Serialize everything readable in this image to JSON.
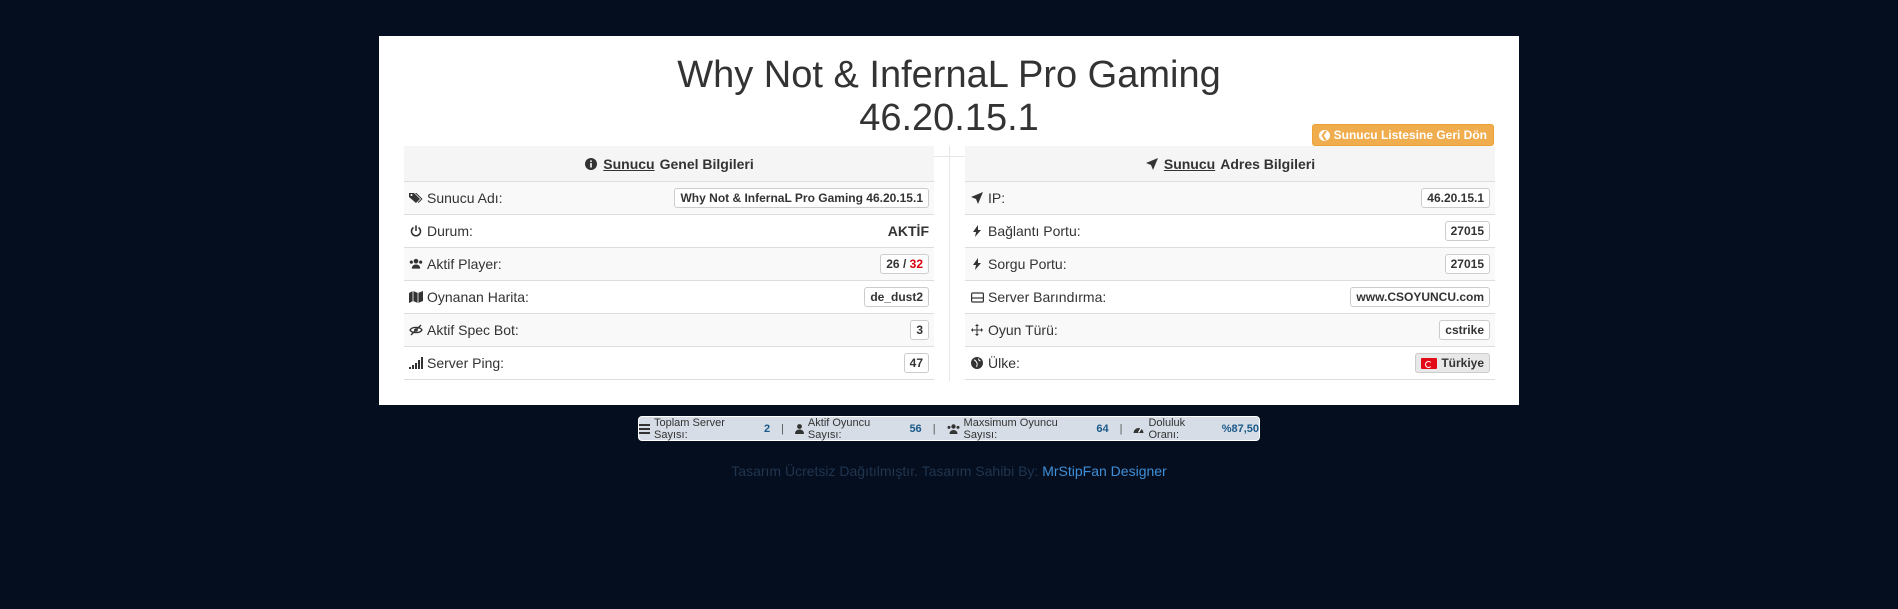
{
  "title": "Why Not & InfernaL Pro Gaming 46.20.15.1",
  "back_button": "Sunucu Listesine Geri Dön",
  "general": {
    "heading_pre": "Sunucu",
    "heading_post": "Genel Bilgileri",
    "rows": [
      {
        "label": "Sunucu Adı:",
        "value": "Why Not & InfernaL Pro Gaming 46.20.15.1",
        "icon": "tags-icon"
      },
      {
        "label": "Durum:",
        "value": "AKTİF",
        "icon": "power-icon"
      },
      {
        "label": "Aktif Player:",
        "value_a": "26",
        "value_sep": "/",
        "value_b": "32",
        "icon": "users-icon"
      },
      {
        "label": "Oynanan Harita:",
        "value": "de_dust2",
        "icon": "map-icon"
      },
      {
        "label": "Aktif Spec Bot:",
        "value": "3",
        "icon": "eye-slash-icon"
      },
      {
        "label": "Server Ping:",
        "value": "47",
        "icon": "signal-icon"
      }
    ]
  },
  "address": {
    "heading_pre": "Sunucu",
    "heading_post": "Adres Bilgileri",
    "rows": [
      {
        "label": "IP:",
        "value": "46.20.15.1",
        "icon": "location-arrow-icon"
      },
      {
        "label": "Bağlantı Portu:",
        "value": "27015",
        "icon": "bolt-icon"
      },
      {
        "label": "Sorgu Portu:",
        "value": "27015",
        "icon": "bolt-icon"
      },
      {
        "label": "Server Barındırma:",
        "value": "www.CSOYUNCU.com",
        "icon": "hdd-icon"
      },
      {
        "label": "Oyun Türü:",
        "value": "cstrike",
        "icon": "crosshairs-icon"
      },
      {
        "label": "Ülke:",
        "value": "Türkiye",
        "icon": "globe-icon"
      }
    ]
  },
  "stats": {
    "total_label": "Toplam Server Sayısı:",
    "total_value": "2",
    "active_label": "Aktif Oyuncu Sayısı:",
    "active_value": "56",
    "max_label": "Maxsimum Oyuncu Sayısı:",
    "max_value": "64",
    "fill_label": "Doluluk Oranı:",
    "fill_value": "%87,50"
  },
  "footer": {
    "text": "Tasarım Ücretsiz Dağıtılmıştır. Tasarım Sahibi By:",
    "link": "MrStipFan Designer"
  },
  "colors": {
    "background": "#050e1f",
    "accent_orange": "#f0ad4e",
    "red": "#d9000f",
    "link": "#3f8fd8"
  }
}
